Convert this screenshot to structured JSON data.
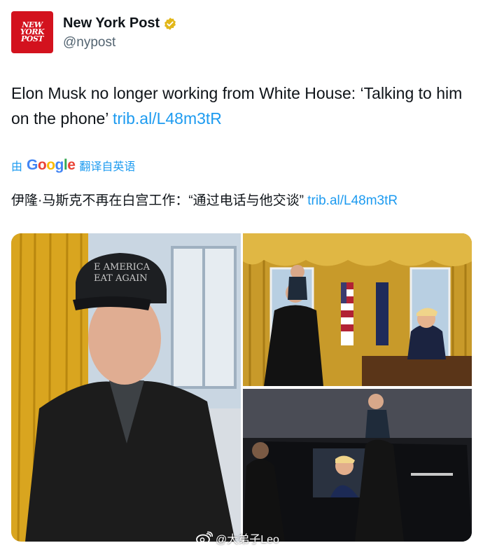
{
  "account": {
    "logo_lines": [
      "NEW",
      "YORK",
      "POST"
    ],
    "name": "New York Post",
    "handle": "@nypost",
    "verified_color": "#e2b719"
  },
  "tweet": {
    "text": "Elon Musk no longer working from White House: ‘Talking to him on the phone’ ",
    "link": "trib.al/L48m3tR"
  },
  "translation": {
    "prefix": "由",
    "google": [
      "G",
      "o",
      "o",
      "g",
      "l",
      "e"
    ],
    "suffix": "翻译自英语",
    "text": "伊隆·马斯克不再在白宫工作：“通过电话与他交谈” ",
    "link": "trib.al/L48m3tR"
  },
  "media": {
    "hat_text_line1": "E AMERICA",
    "hat_text_line2": "EAT AGAIN"
  },
  "watermark": {
    "text": "@大弟子Leo",
    "icon": "weibo-icon"
  },
  "colors": {
    "brand_red": "#d3121e",
    "link": "#1d9bf0",
    "handle_gray": "#536471"
  }
}
